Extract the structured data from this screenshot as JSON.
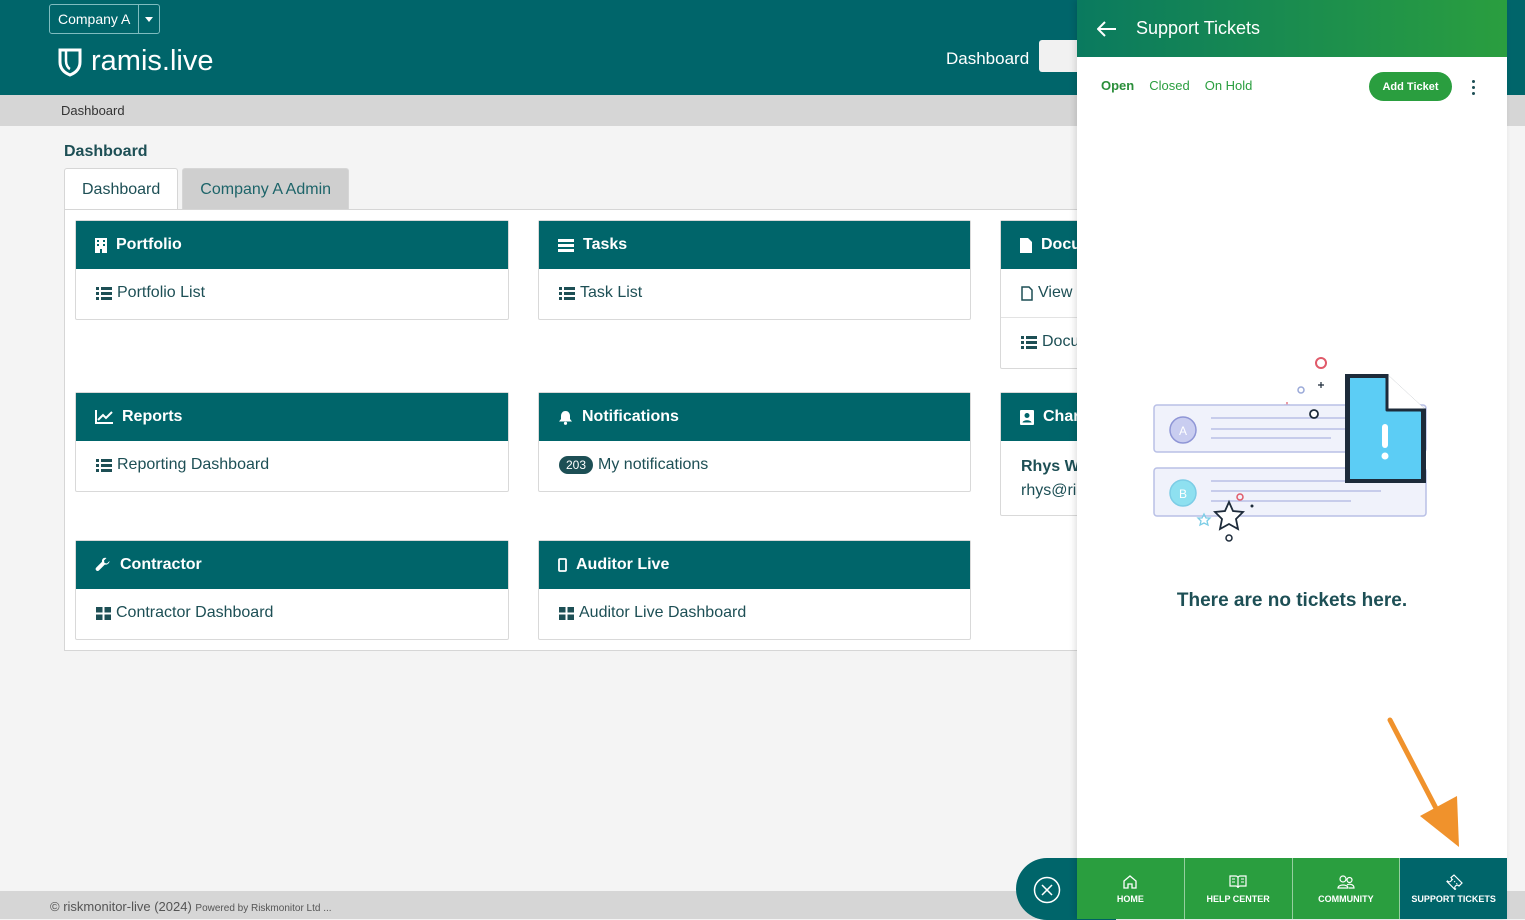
{
  "header": {
    "company": "Company A",
    "logo_text": "ramis.live",
    "nav_dashboard": "Dashboard"
  },
  "breadcrumb": "Dashboard",
  "page_title": "Dashboard",
  "tabs": [
    "Dashboard",
    "Company A Admin"
  ],
  "cards": {
    "portfolio": {
      "title": "Portfolio",
      "link": "Portfolio List"
    },
    "tasks": {
      "title": "Tasks",
      "link": "Task List"
    },
    "documents": {
      "title": "Docu",
      "link1": "View",
      "link2": "Docu"
    },
    "reports": {
      "title": "Reports",
      "link": "Reporting Dashboard"
    },
    "notifications": {
      "title": "Notifications",
      "badge": "203",
      "link": "My notifications"
    },
    "champion": {
      "title": "Char",
      "name": "Rhys W",
      "email": "rhys@ris"
    },
    "contractor": {
      "title": "Contractor",
      "link": "Contractor Dashboard"
    },
    "auditor": {
      "title": "Auditor Live",
      "link": "Auditor Live Dashboard"
    }
  },
  "footer": {
    "copyright": "© riskmonitor-live (2024)",
    "powered": "Powered by Riskmonitor Ltd ..."
  },
  "panel": {
    "title": "Support Tickets",
    "filters": [
      "Open",
      "Closed",
      "On Hold"
    ],
    "add_ticket": "Add Ticket",
    "empty_message": "There are no tickets here.",
    "illustration_letters": [
      "A",
      "B"
    ],
    "bottom_nav": [
      "HOME",
      "HELP CENTER",
      "COMMUNITY",
      "SUPPORT TICKETS"
    ]
  },
  "colors": {
    "brand": "#00656a",
    "green": "#2a9e3f",
    "arrow": "#f0922c"
  }
}
